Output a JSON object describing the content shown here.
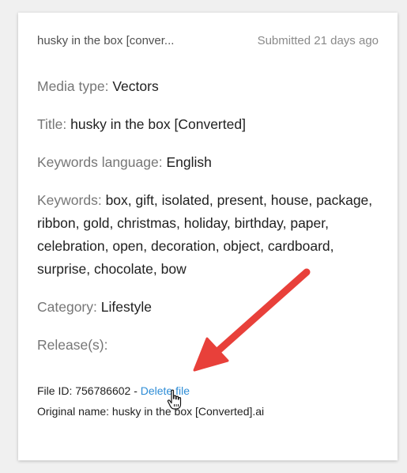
{
  "card": {
    "file_name_short": "husky in the box [conver...",
    "submitted": "Submitted 21 days ago",
    "media_type": {
      "label": "Media type:",
      "value": "Vectors"
    },
    "title": {
      "label": "Title:",
      "value": "husky in the box [Converted]"
    },
    "keywords_language": {
      "label": "Keywords language:",
      "value": "English"
    },
    "keywords": {
      "label": "Keywords:",
      "value": "box, gift, isolated, present, house, package, ribbon, gold, christmas, holiday, birthday, paper, celebration, open, decoration, object, cardboard, surprise, chocolate, bow"
    },
    "category": {
      "label": "Category:",
      "value": "Lifestyle"
    },
    "releases": {
      "label": "Release(s):"
    },
    "file_id": {
      "label": "File ID: 756786602 -",
      "delete_link": "Delete file"
    },
    "original_name": "Original name: husky in the box [Converted].ai"
  },
  "colors": {
    "arrow": "#e8403a",
    "link": "#2d8cd6"
  },
  "icons": [
    "arrow-annotation-icon",
    "hand-pointer-icon"
  ]
}
